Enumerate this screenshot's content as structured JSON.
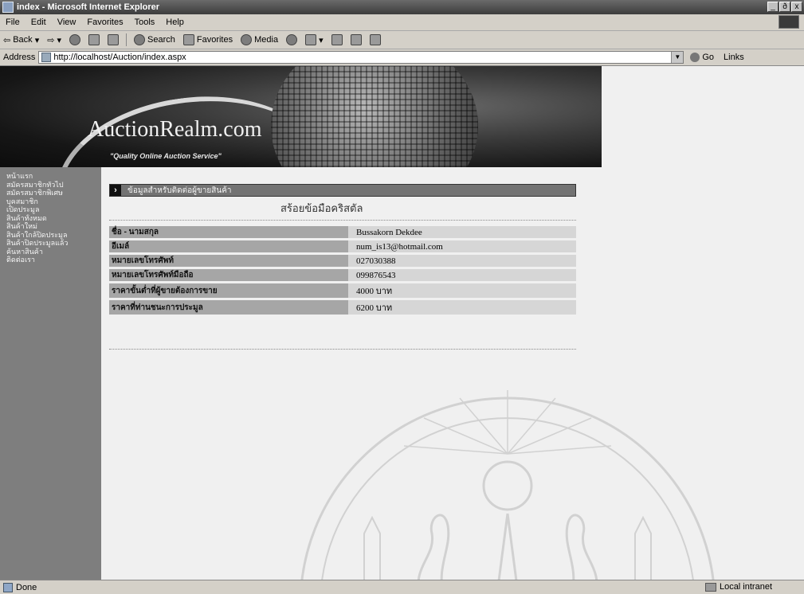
{
  "window": {
    "title": "index - Microsoft Internet Explorer",
    "buttons": [
      "_",
      "ð",
      "x"
    ]
  },
  "menu": [
    "File",
    "Edit",
    "View",
    "Favorites",
    "Tools",
    "Help"
  ],
  "toolbar": {
    "back": "Back",
    "search": "Search",
    "favorites": "Favorites",
    "media": "Media"
  },
  "address": {
    "label": "Address",
    "url": "http://localhost/Auction/index.aspx",
    "go": "Go",
    "links": "Links"
  },
  "banner": {
    "brand": "AuctionRealm.com",
    "tagline": "\"Quality Online Auction Service\""
  },
  "sidebar": {
    "items": [
      "หน้าแรก",
      "สมัครสมาชิกทั่วไป",
      "สมัครสมาชิกพิเศษ",
      "บุคสมาชิก",
      "เปิดประมูล",
      "สินค้าทั้งหมด",
      "สินค้าใหม่",
      "สินค้าใกล้ปิดประมูล",
      "สินค้าปิดประมูลแล้ว",
      "ค้นหาสินค้า",
      "ติดต่อเรา"
    ]
  },
  "section": {
    "header": "ข้อมูลสำหรับติดต่อผู้ขายสินค้า",
    "subtitle": "สร้อยข้อมือคริสตัล"
  },
  "info": [
    {
      "label": "ชื่อ - นามสกุล",
      "value": "Bussakorn Dekdee"
    },
    {
      "label": "อีเมล์",
      "value": "num_is13@hotmail.com"
    },
    {
      "label": "หมายเลขโทรศัพท์",
      "value": "027030388"
    },
    {
      "label": "หมายเลขโทรศัพท์มือถือ",
      "value": "099876543"
    },
    {
      "label": "ราคาขั้นต่ำที่ผู้ขายต้องการขาย",
      "value": "4000 บาท"
    },
    {
      "label": "ราคาที่ท่านชนะการประมูล",
      "value": "6200 บาท"
    }
  ],
  "status": {
    "left": "Done",
    "zone": "Local intranet"
  }
}
